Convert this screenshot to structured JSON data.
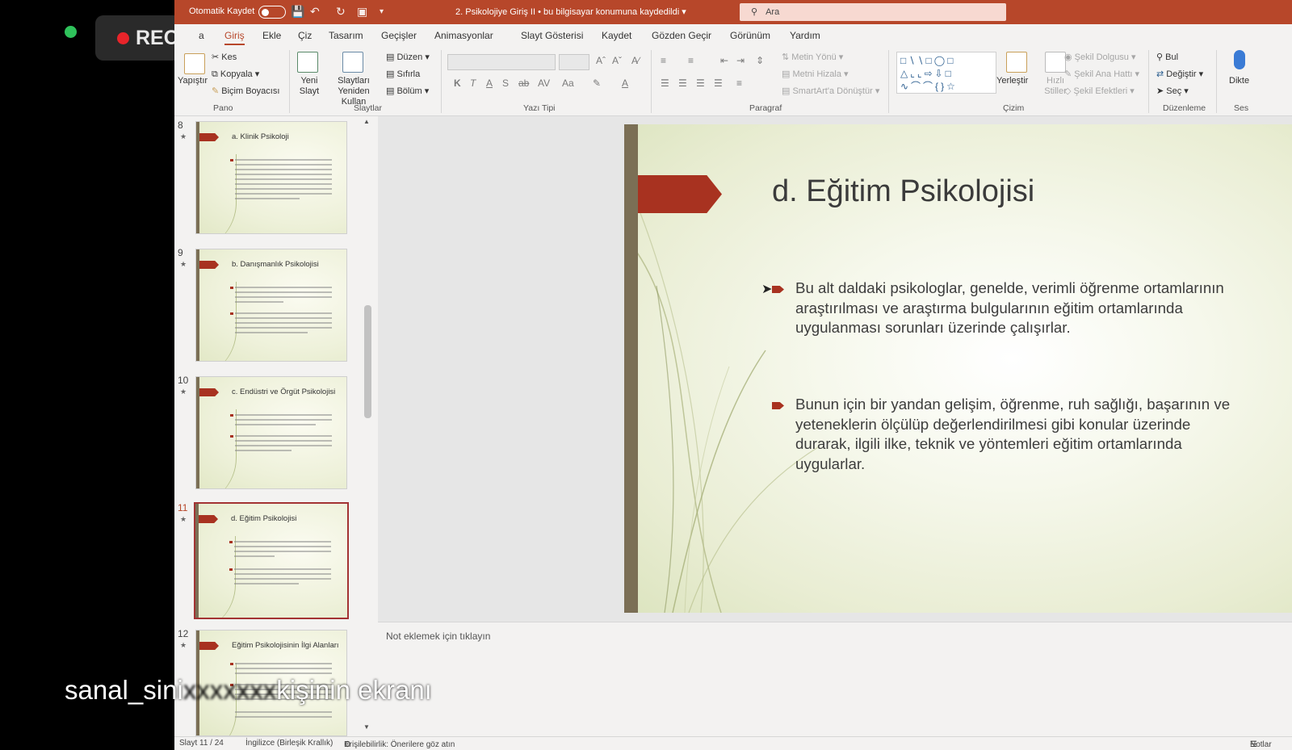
{
  "overlay": {
    "rec_label": "REC",
    "caption_left": "sanal_sini",
    "caption_right": "kişinin ekranı"
  },
  "titlebar": {
    "autosave_label": "Otomatik Kaydet",
    "document_title": "2. Psikolojiye Giriş II • bu bilgisayar konumuna kaydedildi",
    "search_placeholder": "Ara"
  },
  "tabs": [
    {
      "label": "a",
      "active": false
    },
    {
      "label": "Giriş",
      "active": true
    },
    {
      "label": "Ekle",
      "active": false
    },
    {
      "label": "Çiz",
      "active": false
    },
    {
      "label": "Tasarım",
      "active": false
    },
    {
      "label": "Geçişler",
      "active": false
    },
    {
      "label": "Animasyonlar",
      "active": false
    },
    {
      "label": "Slayt Gösterisi",
      "active": false
    },
    {
      "label": "Kaydet",
      "active": false
    },
    {
      "label": "Gözden Geçir",
      "active": false
    },
    {
      "label": "Görünüm",
      "active": false
    },
    {
      "label": "Yardım",
      "active": false
    }
  ],
  "ribbon": {
    "clipboard": {
      "paste": "Yapıştır",
      "cut": "Kes",
      "copy": "Kopyala",
      "format_painter": "Biçim Boyacısı",
      "group": "Pano"
    },
    "slides": {
      "new_slide": "Yeni Slayt",
      "reuse": "Slaytları Yeniden Kullan",
      "layout": "Düzen",
      "reset": "Sıfırla",
      "section": "Bölüm",
      "group": "Slaytlar"
    },
    "font": {
      "bold": "K",
      "italic": "T",
      "underline": "A",
      "shadow": "S",
      "case": "Aa",
      "group": "Yazı Tipi"
    },
    "paragraph": {
      "text_direction": "Metin Yönü",
      "align_text": "Metni Hizala",
      "smartart": "SmartArt'a Dönüştür",
      "group": "Paragraf"
    },
    "drawing": {
      "arrange": "Yerleştir",
      "quick_styles": "Hızlı Stiller",
      "fill": "Şekil Dolgusu",
      "outline": "Şekil Ana Hattı",
      "effects": "Şekil Efektleri",
      "group": "Çizim"
    },
    "editing": {
      "find": "Bul",
      "replace": "Değiştir",
      "select": "Seç",
      "group": "Düzenleme"
    },
    "voice": {
      "dictate": "Dikte",
      "group": "Ses"
    }
  },
  "thumbnails": [
    {
      "number": "8",
      "title": "a. Klinik Psikoloji",
      "selected": false
    },
    {
      "number": "9",
      "title": "b. Danışmanlık Psikolojisi",
      "selected": false
    },
    {
      "number": "10",
      "title": "c. Endüstri ve Örgüt Psikolojisi",
      "selected": false
    },
    {
      "number": "11",
      "title": "d. Eğitim Psikolojisi",
      "selected": true
    },
    {
      "number": "12",
      "title": "Eğitim Psikolojisinin İlgi Alanları",
      "selected": false
    }
  ],
  "slide": {
    "title": "d. Eğitim Psikolojisi",
    "bullets": [
      "Bu alt daldaki psikologlar, genelde, verimli öğrenme ortamlarının araştırılması ve araştırma bulgularının eğitim ortamlarında uygulanması sorunları üzerinde çalışırlar.",
      "Bunun için bir yandan gelişim, öğrenme, ruh sağlığı, başarının ve yeteneklerin ölçülüp değerlendirilmesi gibi konular üzerinde durarak, ilgili ilke, teknik ve yöntemleri eğitim ortamlarında uygularlar."
    ]
  },
  "notes_placeholder": "Not eklemek için tıklayın",
  "statusbar": {
    "slide_position": "Slayt 11 / 24",
    "language": "İngilizce (Birleşik Krallık)",
    "accessibility": "Erişilebilirlik: Önerilere göz atın",
    "notes": "Notlar"
  },
  "colors": {
    "accent": "#b7472a",
    "slide_arrow": "#a83220",
    "slide_bar": "#7b6f55",
    "rec_dot": "#e8242a",
    "presence_dot": "#2fc25b"
  }
}
